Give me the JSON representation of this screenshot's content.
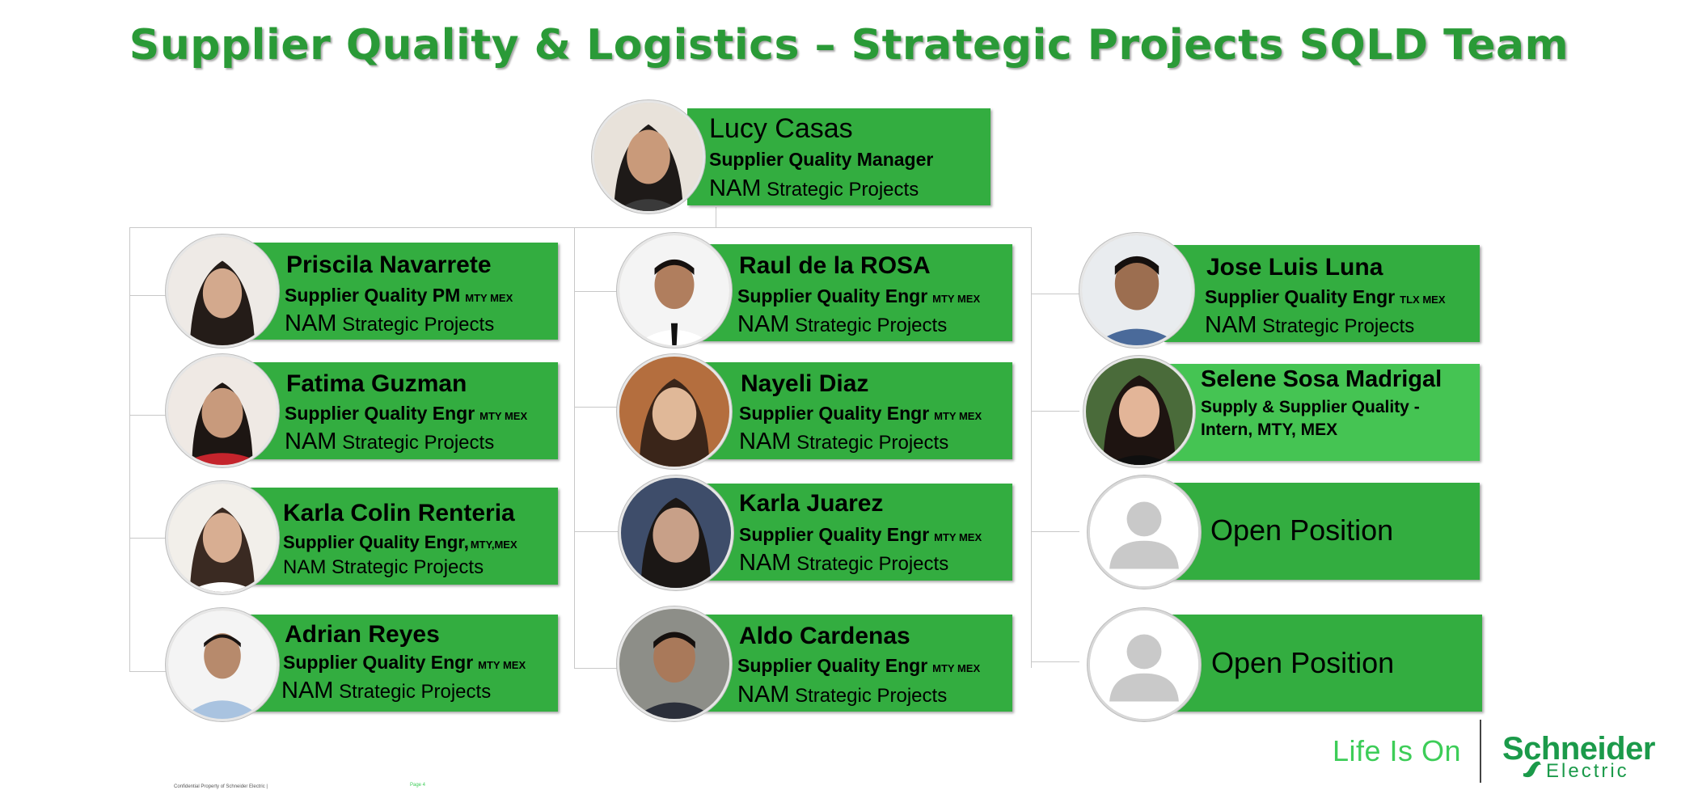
{
  "title": "Supplier Quality & Logistics – Strategic Projects SQLD Team",
  "colors": {
    "card": "#33ad40",
    "intern_card": "#45c453",
    "title": "#2a9a37",
    "brand": "#3dcd58"
  },
  "manager": {
    "name": "Lucy Casas",
    "role": "Supplier Quality Manager",
    "org_prefix": "NAM",
    "org_suffix": "Strategic Projects"
  },
  "team": [
    {
      "name": "Priscila Navarrete",
      "role": "Supplier Quality  PM",
      "loc": "MTY MEX",
      "org_prefix": "NAM",
      "org_suffix": "Strategic Projects"
    },
    {
      "name": "Fatima Guzman",
      "role": "Supplier Quality  Engr",
      "loc": "MTY MEX",
      "org_prefix": "NAM",
      "org_suffix": "Strategic Projects"
    },
    {
      "name": "Karla Colin Renteria",
      "role": "Supplier Quality  Engr,",
      "loc": "MTY,MEX",
      "org_full": "NAM Strategic Projects"
    },
    {
      "name": "Adrian Reyes",
      "role": "Supplier Quality  Engr",
      "loc": "MTY MEX",
      "org_prefix": "NAM",
      "org_suffix": "Strategic Projects"
    },
    {
      "name": "Raul de la ROSA",
      "role": "Supplier Quality  Engr",
      "loc": "MTY MEX",
      "org_prefix": "NAM",
      "org_suffix": "Strategic Projects"
    },
    {
      "name": "Nayeli Diaz",
      "role": "Supplier Quality  Engr",
      "loc": "MTY MEX",
      "org_prefix": "NAM",
      "org_suffix": "Strategic Projects"
    },
    {
      "name": "Karla Juarez",
      "role": "Supplier Quality  Engr",
      "loc": "MTY MEX",
      "org_prefix": "NAM",
      "org_suffix": "Strategic Projects"
    },
    {
      "name": "Aldo Cardenas",
      "role": "Supplier Quality  Engr",
      "loc": "MTY MEX",
      "org_prefix": "NAM",
      "org_suffix": "Strategic Projects"
    },
    {
      "name": "Jose Luis Luna",
      "role": "Supplier Quality  Engr",
      "loc": "TLX MEX",
      "org_prefix": "NAM",
      "org_suffix": "Strategic Projects"
    },
    {
      "name": "Selene Sosa Madrigal",
      "role_intern": "Supply & Supplier Quality - Intern, MTY, MEX"
    },
    {
      "open_label": "Open Position"
    },
    {
      "open_label": "Open Position"
    }
  ],
  "brand": {
    "tagline": "Life Is On",
    "name_line1": "Schneider",
    "name_line2": "Electric"
  },
  "footer": {
    "note": "Confidential Property of Schneider Electric |",
    "page": "Page 4"
  }
}
